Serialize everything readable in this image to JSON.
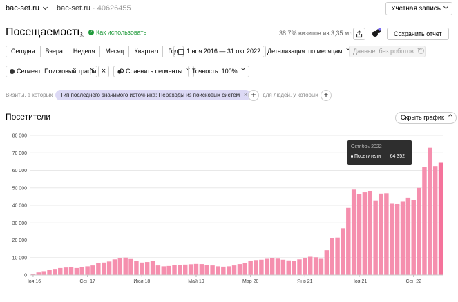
{
  "header": {
    "site": "bac-set.ru",
    "counter_name": "bac-set.ru",
    "counter_sep": " · ",
    "counter_id": "40626455",
    "account": "Учетная запись"
  },
  "page": {
    "title": "Посещаемость",
    "howto": "Как использовать",
    "visits_share": "38,7% визитов из 3,35 млн",
    "save_report": "Сохранить отчет"
  },
  "period": {
    "buttons": [
      "Сегодня",
      "Вчера",
      "Неделя",
      "Месяц",
      "Квартал",
      "Год"
    ],
    "date_range": "1 ноя 2016 — 31 окт 2022",
    "detail": "Детализация: по месяцам",
    "data": "Данные: без роботов"
  },
  "segments": {
    "segment": "Сегмент: Поисковый трафик",
    "compare": "Сравнить сегменты",
    "accuracy": "Точность: 100%"
  },
  "filters": {
    "visits_label": "Визиты, в которых",
    "chip": "Тип последнего значимого источника: Переходы из поисковых систем",
    "people_label": "для людей, у которых"
  },
  "chart_section": {
    "title": "Посетители",
    "hide_chart": "Скрыть график"
  },
  "tooltip": {
    "period": "Октябрь 2022",
    "label": "Посетители",
    "value": "64 352"
  },
  "colors": {
    "bar": "#f58fae",
    "bar_highlight": "#f5739b",
    "tooltip_bg": "#2e2e2e",
    "grid": "#e8e8e8"
  },
  "chart_data": {
    "type": "bar",
    "ylim": [
      0,
      80000
    ],
    "yticks": [
      0,
      10000,
      20000,
      30000,
      40000,
      50000,
      60000,
      70000,
      80000
    ],
    "ytick_labels": [
      "0",
      "10 000",
      "20 000",
      "30 000",
      "40 000",
      "50 000",
      "60 000",
      "70 000",
      "80 000"
    ],
    "xtick_labels": [
      {
        "index": 0,
        "label": "Ноя 16"
      },
      {
        "index": 10,
        "label": "Сен 17"
      },
      {
        "index": 20,
        "label": "Июл 18"
      },
      {
        "index": 30,
        "label": "Май 19"
      },
      {
        "index": 40,
        "label": "Мар 20"
      },
      {
        "index": 50,
        "label": "Янв 21"
      },
      {
        "index": 60,
        "label": "Ноя 21"
      },
      {
        "index": 70,
        "label": "Сен 22"
      }
    ],
    "series": [
      {
        "values": [
          800,
          1500,
          2200,
          2800,
          3500,
          4000,
          4300,
          4500,
          4000,
          4500,
          5000,
          5500,
          6800,
          7200,
          7800,
          9000,
          9500,
          10000,
          9200,
          8000,
          7200,
          7500,
          8200,
          5500,
          5000,
          5200,
          5600,
          5800,
          6000,
          6200,
          6400,
          6300,
          5800,
          5500,
          5000,
          4800,
          5000,
          5500,
          6300,
          7000,
          8000,
          8600,
          8800,
          9300,
          9800,
          9400,
          8800,
          8400,
          8300,
          9000,
          9800,
          10500,
          10200,
          9300,
          14200,
          21000,
          21500,
          26800,
          38500,
          49000,
          46500,
          47500,
          48000,
          42500,
          46800,
          47000,
          41000,
          40800,
          42200,
          44400,
          43000,
          50000,
          62000,
          73000,
          62500,
          64352
        ]
      }
    ],
    "highlight_index": 75
  }
}
